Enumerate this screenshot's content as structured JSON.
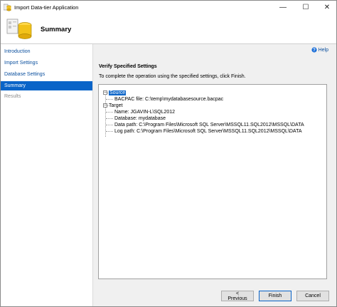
{
  "window": {
    "title": "Import Data-tier Application",
    "minimize": "—",
    "maximize": "☐",
    "close": "✕"
  },
  "header": {
    "title": "Summary"
  },
  "nav": {
    "items": [
      {
        "label": "Introduction",
        "state": "link"
      },
      {
        "label": "Import Settings",
        "state": "link"
      },
      {
        "label": "Database Settings",
        "state": "link"
      },
      {
        "label": "Summary",
        "state": "selected"
      },
      {
        "label": "Results",
        "state": "disabled"
      }
    ]
  },
  "content": {
    "help_label": "Help",
    "section_title": "Verify Specified Settings",
    "instructions": "To complete the operation using the specified settings, click Finish.",
    "tree": {
      "source_label": "Source",
      "source_children": [
        "BACPAC file: C:\\temp\\mydatabasesource.bacpac"
      ],
      "target_label": "Target",
      "target_children": [
        "Name: JGAVIN-L\\SQL2012",
        "Database: mydatabase",
        "Data path: C:\\Program Files\\Microsoft SQL Server\\MSSQL11.SQL2012\\MSSQL\\DATA",
        "Log path: C:\\Program Files\\Microsoft SQL Server\\MSSQL11.SQL2012\\MSSQL\\DATA"
      ],
      "expander": "−"
    }
  },
  "footer": {
    "previous_label": "< Previous",
    "finish_label": "Finish",
    "cancel_label": "Cancel"
  },
  "colors": {
    "selection": "#0a64c8",
    "link": "#0a4f9e",
    "panel": "#f0f0f0"
  }
}
